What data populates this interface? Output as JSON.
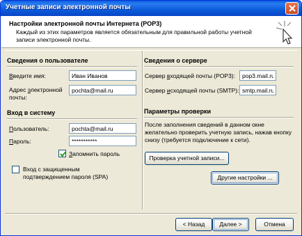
{
  "window": {
    "title": "Учетные записи электронной почты"
  },
  "header": {
    "title": "Настройки электронной почты Интернета (POP3)",
    "description": "Каждый из этих параметров является обязательным для правильной работы учетной записи электронной почты."
  },
  "user_info": {
    "section_title": "Сведения о пользователе",
    "name_label_pre": "",
    "name_label_key": "В",
    "name_label_post": "ведите имя:",
    "name_value": "Иван Иванов",
    "email_label_line1_pre": "Адрес ",
    "email_label_line1_key": "э",
    "email_label_line1_post": "лектронной",
    "email_label_line2": "почты:",
    "email_value": "pochta@mail.ru"
  },
  "login": {
    "section_title": "Вход в систему",
    "user_label_pre": "",
    "user_label_key": "П",
    "user_label_post": "ользователь:",
    "user_value": "pochta@mail.ru",
    "password_label_pre": "",
    "password_label_key": "П",
    "password_label_post": "ароль:",
    "password_value": "***********",
    "remember_label_pre": "",
    "remember_label_key": "З",
    "remember_label_post": "апомнить пароль",
    "remember_checked": true,
    "spa_label_line1": "Вход с защищенным",
    "spa_label_line2": "подтверждением пароля (SPA)",
    "spa_checked": false
  },
  "server_info": {
    "section_title": "Сведения о сервере",
    "incoming_label_pre": "Сервер ",
    "incoming_label_key": "в",
    "incoming_label_post": "ходящей почты (POP3):",
    "incoming_value": "pop3.mail.ru",
    "outgoing_label_pre": "Сервер ",
    "outgoing_label_key": "и",
    "outgoing_label_post": "сходящей почты (SMTP):",
    "outgoing_value": "smtp.mail.ru"
  },
  "test": {
    "section_title": "Параметры проверки",
    "description": "После заполнения сведений в данном окне желательно проверить учетную запись, нажав кнопку снизу (требуется подключение к сети).",
    "test_button": "Проверка учетной записи...",
    "more_settings_button": "Другие настройки ..."
  },
  "footer": {
    "back_button": "< Назад",
    "next_button": "Далее >",
    "cancel_button": "Отмена"
  },
  "colors": {
    "titlebar": "#0b5bd9",
    "dialog_bg": "#ece9d8",
    "input_border": "#7f9db9",
    "checkmark": "#21a121"
  }
}
